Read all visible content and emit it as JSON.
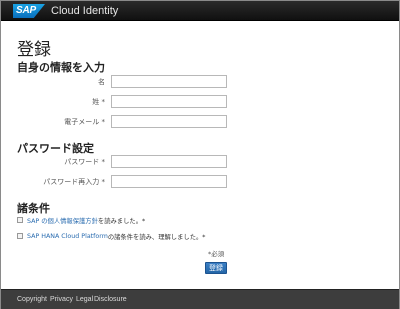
{
  "brand": {
    "logo_text": "SAP",
    "app_name": "Cloud Identity"
  },
  "page": {
    "title": "登録"
  },
  "personal": {
    "heading": "自身の情報を入力",
    "fields": [
      {
        "label": "名",
        "value": ""
      },
      {
        "label": "姓 *",
        "value": ""
      },
      {
        "label": "電子メール *",
        "value": ""
      }
    ]
  },
  "password": {
    "heading": "パスワード設定",
    "fields": [
      {
        "label": "パスワード *",
        "value": ""
      },
      {
        "label": "パスワード再入力 *",
        "value": ""
      }
    ]
  },
  "terms": {
    "heading": "諸条件",
    "items": [
      {
        "link": "SAP の個人情報保護方針",
        "text": "を読みました。*"
      },
      {
        "link": "SAP HANA Cloud Platform",
        "text": " の諸条件を読み、理解しました。*"
      }
    ]
  },
  "required_note": "*必須",
  "submit_label": "登録",
  "footer": {
    "links": [
      "Copyright",
      "Privacy",
      "Legal",
      "Disclosure"
    ]
  }
}
